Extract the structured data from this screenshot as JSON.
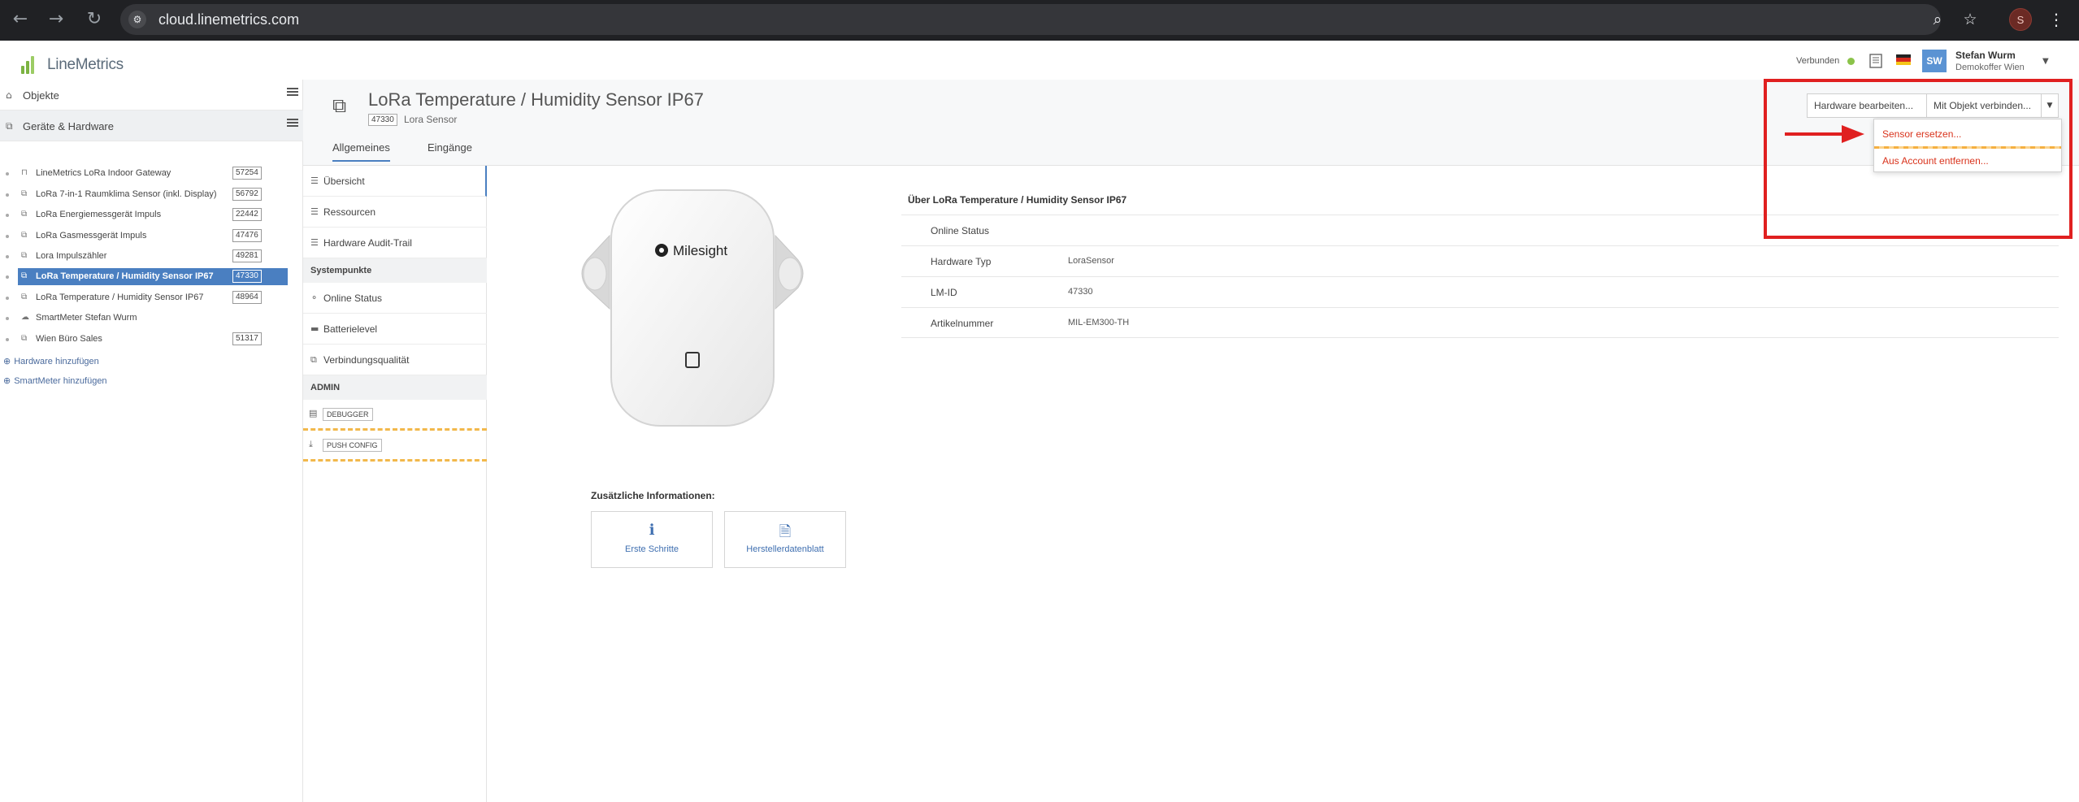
{
  "browser": {
    "url": "cloud.linemetrics.com",
    "profile_initial": "S"
  },
  "header": {
    "logo_text": "LineMetrics",
    "status_label": "Verbunden",
    "avatar_initials": "SW",
    "user_name": "Stefan Wurm",
    "user_org": "Demokoffer Wien"
  },
  "sidebar": {
    "sections": [
      {
        "label": "Objekte"
      },
      {
        "label": "Geräte & Hardware"
      }
    ],
    "items": [
      {
        "label": "LineMetrics LoRa Indoor Gateway",
        "id": "57254"
      },
      {
        "label": "LoRa 7-in-1 Raumklima Sensor (inkl. Display)",
        "id": "56792"
      },
      {
        "label": "LoRa Energiemessgerät Impuls",
        "id": "22442"
      },
      {
        "label": "LoRa Gasmessgerät Impuls",
        "id": "47476"
      },
      {
        "label": "Lora Impulszähler",
        "id": "49281"
      },
      {
        "label": "LoRa Temperature / Humidity Sensor IP67",
        "id": "47330"
      },
      {
        "label": "LoRa Temperature / Humidity Sensor IP67",
        "id": "48964"
      },
      {
        "label": "SmartMeter Stefan Wurm",
        "id": ""
      },
      {
        "label": "Wien Büro Sales",
        "id": "51317"
      }
    ],
    "links": [
      {
        "label": "Hardware hinzufügen"
      },
      {
        "label": "SmartMeter hinzufügen"
      }
    ]
  },
  "page": {
    "title": "LoRa Temperature / Humidity Sensor IP67",
    "id_badge": "47330",
    "subtitle": "Lora Sensor",
    "tabs": [
      {
        "label": "Allgemeines"
      },
      {
        "label": "Eingänge"
      }
    ]
  },
  "actions": {
    "edit_hardware": "Hardware bearbeiten...",
    "connect_object": "Mit Objekt verbinden...",
    "dropdown": [
      {
        "label": "Sensor ersetzen..."
      },
      {
        "label": "Aus Account entfernen..."
      }
    ]
  },
  "subnav": {
    "overview": "Übersicht",
    "resources": "Ressourcen",
    "audit": "Hardware Audit-Trail",
    "system_section": "Systempunkte",
    "online_status": "Online Status",
    "battery": "Batterielevel",
    "connection": "Verbindungsqualität",
    "admin_section": "ADMIN",
    "debugger": "DEBUGGER",
    "push_config": "PUSH CONFIG"
  },
  "device": {
    "brand": "Milesight",
    "info_title": "Über LoRa Temperature / Humidity Sensor IP67",
    "rows": [
      {
        "key": "Online Status",
        "value": ""
      },
      {
        "key": "Hardware Typ",
        "value": "LoraSensor"
      },
      {
        "key": "LM-ID",
        "value": "47330"
      },
      {
        "key": "Artikelnummer",
        "value": "MIL-EM300-TH"
      }
    ],
    "extra_title": "Zusätzliche Informationen:",
    "cards": [
      {
        "label": "Erste Schritte",
        "icon": "info-icon"
      },
      {
        "label": "Herstellerdatenblatt",
        "icon": "pdf-icon"
      }
    ]
  },
  "colors": {
    "accent": "#4a7fc1",
    "danger": "#d9331c",
    "annotation": "#e02020",
    "status_ok": "#8bc34a"
  }
}
